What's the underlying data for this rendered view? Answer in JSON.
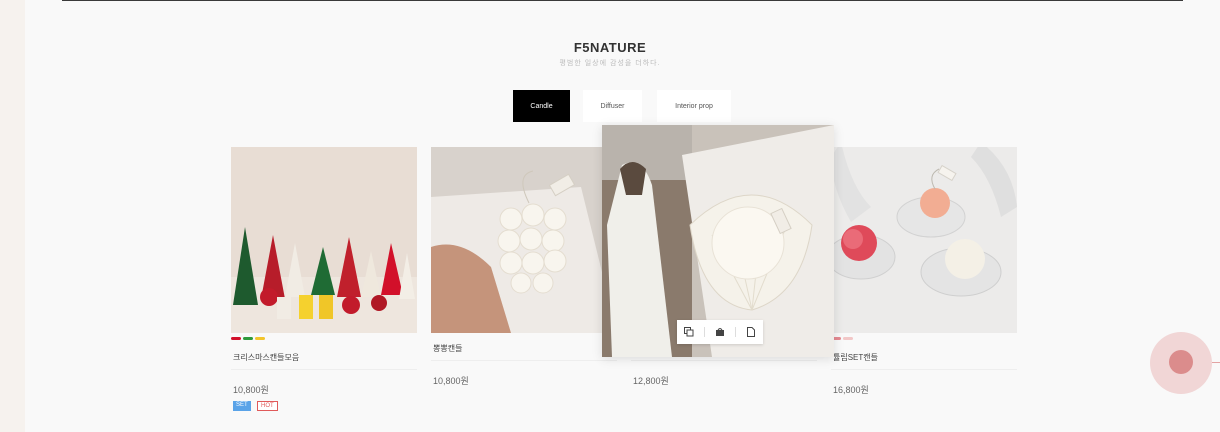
{
  "shop": {
    "brand": "F5NATURE",
    "tagline": "평범한 일상에 감성을 더하다."
  },
  "tabs": [
    {
      "label": "Candle",
      "active": true
    },
    {
      "label": "Diffuser",
      "active": false
    },
    {
      "label": "Interior prop",
      "active": false
    }
  ],
  "products": [
    {
      "name": "크리스마스캔들모음",
      "price": "10,800원",
      "color_dots": [
        "#d2102a",
        "#2e9a3c",
        "#f3c52b"
      ],
      "badges": [
        "SET",
        "HOT"
      ]
    },
    {
      "name": "뽕뽕캔들",
      "price": "10,800원"
    },
    {
      "name": "",
      "price": "12,800원"
    },
    {
      "name": "튤립SET캔들",
      "price": "16,800원",
      "color_dots": [
        "#e58a92",
        "#f2c7c7"
      ]
    }
  ],
  "quick_actions": [
    "copy-icon",
    "bag-icon",
    "document-icon"
  ],
  "colors": {
    "accent_active_tab": "#000000",
    "badge_set": "#5aa3e8",
    "badge_hot": "#e05a5a",
    "float_button": "#db8c8c"
  }
}
